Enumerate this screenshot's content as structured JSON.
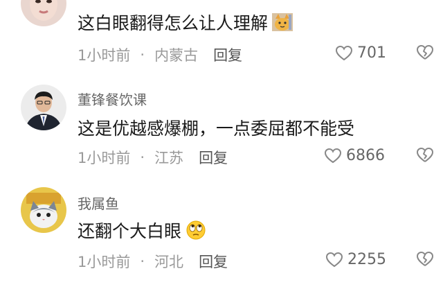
{
  "comments": [
    {
      "username": "",
      "content": "这白眼翻得怎么让人理解",
      "emoji": "cat-face-emoji",
      "time": "1小时前",
      "location": "内蒙古",
      "reply_label": "回复",
      "likes": "701"
    },
    {
      "username": "董锋餐饮课",
      "content": "这是优越感爆棚，一点委屈都不能受",
      "emoji": "",
      "time": "1小时前",
      "location": "江苏",
      "reply_label": "回复",
      "likes": "6866"
    },
    {
      "username": "我属鱼",
      "content": "还翻个大白眼",
      "emoji": "eye-roll-emoji",
      "time": "1小时前",
      "location": "河北",
      "reply_label": "回复",
      "likes": "2255"
    }
  ],
  "separator": "·",
  "colors": {
    "meta_gray": "#999999",
    "username_gray": "#666666",
    "text": "#1a1a1a"
  }
}
